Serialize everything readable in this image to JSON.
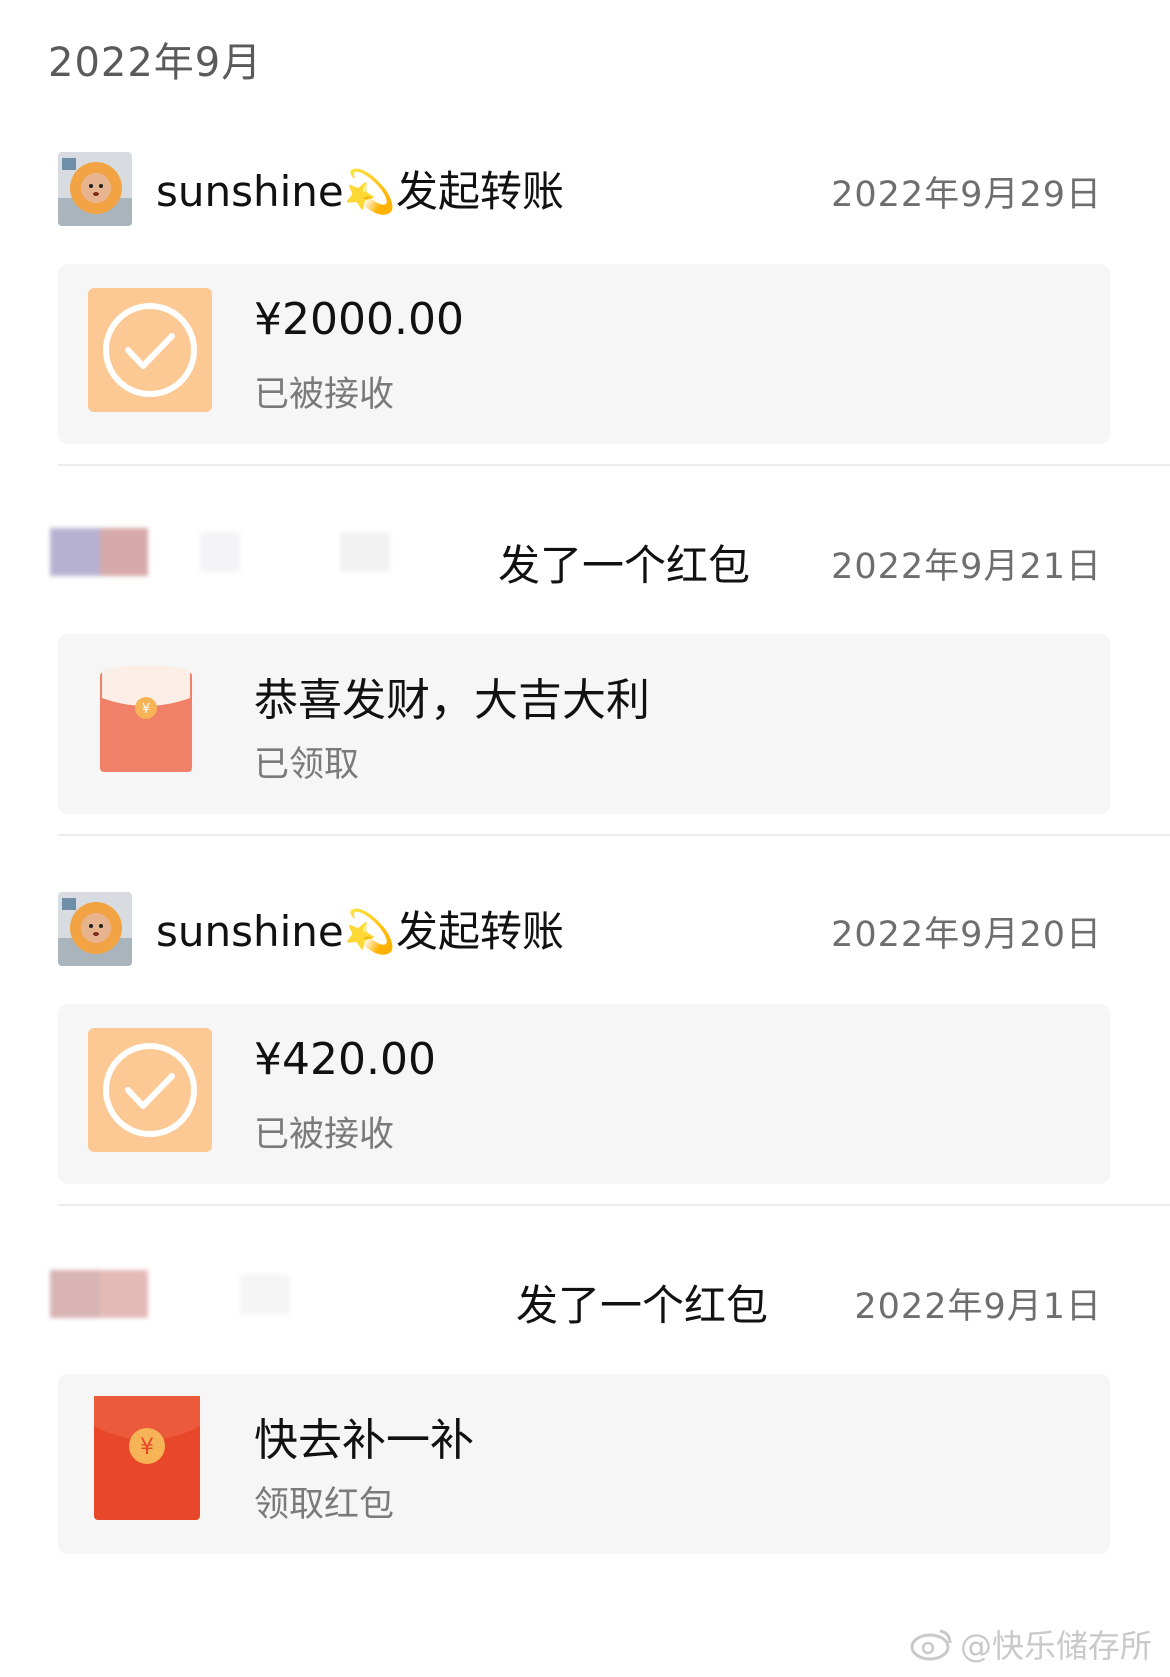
{
  "month_heading": "2022年9月",
  "entries": [
    {
      "sender_name": "sunshine",
      "sender_emoji": "💫",
      "action": "发起转账",
      "date": "2022年9月29日",
      "card": {
        "title": "¥2000.00",
        "status": "已被接收",
        "icon": "check-circle-icon"
      }
    },
    {
      "sender_name": "",
      "action": "发了一个红包",
      "date": "2022年9月21日",
      "card": {
        "title": "恭喜发财，大吉大利",
        "status": "已领取",
        "icon": "opened-red-envelope-icon"
      }
    },
    {
      "sender_name": "sunshine",
      "sender_emoji": "💫",
      "action": "发起转账",
      "date": "2022年9月20日",
      "card": {
        "title": "¥420.00",
        "status": "已被接收",
        "icon": "check-circle-icon"
      }
    },
    {
      "sender_name": "",
      "action": "发了一个红包",
      "date": "2022年9月1日",
      "card": {
        "title": "快去补一补",
        "status": "领取红包",
        "icon": "red-envelope-icon"
      }
    }
  ],
  "watermark": "@快乐储存所",
  "colors": {
    "transfer_icon_bg": "#fcc995",
    "card_bg": "#f6f6f6",
    "opened_envelope": "#f08067",
    "red_envelope": "#e8472a",
    "coin": "#f7b456",
    "date_text": "#6e6e6e"
  }
}
